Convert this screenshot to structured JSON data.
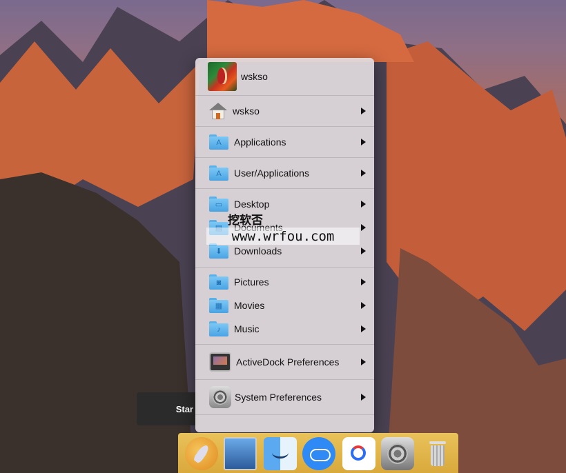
{
  "background_start_button": {
    "label": "Star"
  },
  "menu": {
    "user": {
      "name": "wskso"
    },
    "items": [
      {
        "label": "wskso",
        "icon": "home-icon"
      },
      {
        "label": "Applications",
        "icon": "folder-applications-icon"
      },
      {
        "label": "User/Applications",
        "icon": "folder-applications-icon"
      },
      {
        "label": "Desktop",
        "icon": "folder-desktop-icon"
      },
      {
        "label": "Documents",
        "icon": "folder-documents-icon"
      },
      {
        "label": "Downloads",
        "icon": "folder-downloads-icon"
      },
      {
        "label": "Pictures",
        "icon": "folder-pictures-icon"
      },
      {
        "label": "Movies",
        "icon": "folder-movies-icon"
      },
      {
        "label": "Music",
        "icon": "folder-music-icon"
      },
      {
        "label": "ActiveDock Preferences",
        "icon": "monitor-icon"
      },
      {
        "label": "System Preferences",
        "icon": "system-preferences-icon"
      }
    ]
  },
  "watermark": {
    "line1": "挖软否",
    "line2": "www.wrfou.com"
  },
  "dock": {
    "items": [
      "launchpad-icon",
      "mission-control-icon",
      "finder-icon",
      "icloud-icon",
      "baidu-netdisk-icon",
      "system-preferences-icon",
      "trash-icon"
    ]
  },
  "colors": {
    "dock": "#e0b448",
    "menu_bg": "#e1dcde",
    "folder": "#5cb0ea"
  }
}
